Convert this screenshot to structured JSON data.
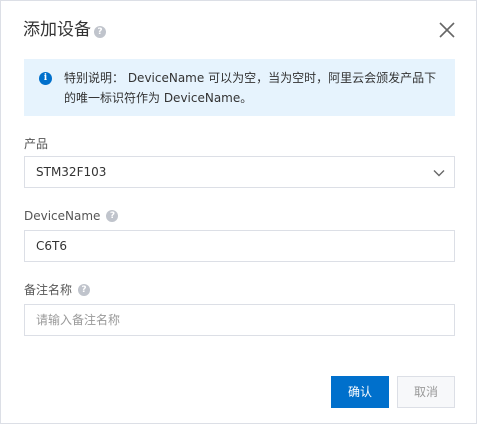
{
  "dialog": {
    "title": "添加设备",
    "help_glyph": "?",
    "close_label": "×"
  },
  "notice": {
    "icon_glyph": "i",
    "text": "特别说明： DeviceName 可以为空，当为空时，阿里云会颁发产品下的唯一标识符作为 DeviceName。"
  },
  "form": {
    "product": {
      "label": "产品",
      "value": "STM32F103"
    },
    "device_name": {
      "label": "DeviceName",
      "value": "C6T6"
    },
    "remark": {
      "label": "备注名称",
      "value": "",
      "placeholder": "请输入备注名称"
    }
  },
  "footer": {
    "confirm_label": "确认",
    "cancel_label": "取消"
  },
  "colors": {
    "primary": "#0070cc",
    "notice_bg": "#e6f3fd",
    "border": "#dcdfe6"
  }
}
